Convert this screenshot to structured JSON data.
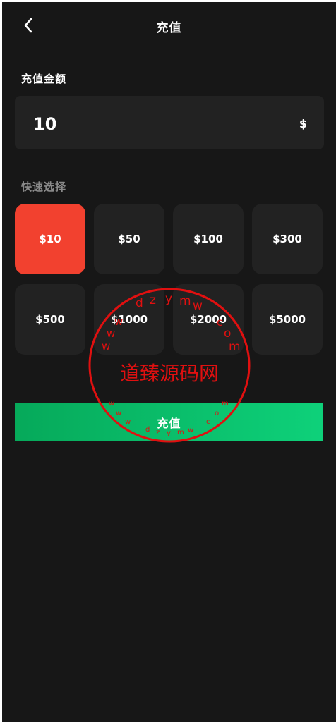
{
  "header": {
    "back_icon": "chevron-left-icon",
    "title": "充值"
  },
  "amount": {
    "label": "充值金额",
    "value": "10",
    "currency": "$"
  },
  "quick_select": {
    "label": "快速选择",
    "selected_index": 0,
    "options": [
      "$10",
      "$50",
      "$100",
      "$300",
      "$500",
      "$1000",
      "$2000",
      "$5000"
    ]
  },
  "submit": {
    "label": "充值"
  },
  "watermark": {
    "center_text": "道臻源码网",
    "outer_text": "dzymwcom",
    "inner_text": "wwwdzymwcom"
  },
  "colors": {
    "background": "#171717",
    "card": "#222222",
    "selected": "#f2412f",
    "button_start": "#06a95a",
    "button_end": "#0ed17a",
    "watermark": "#e01010"
  }
}
